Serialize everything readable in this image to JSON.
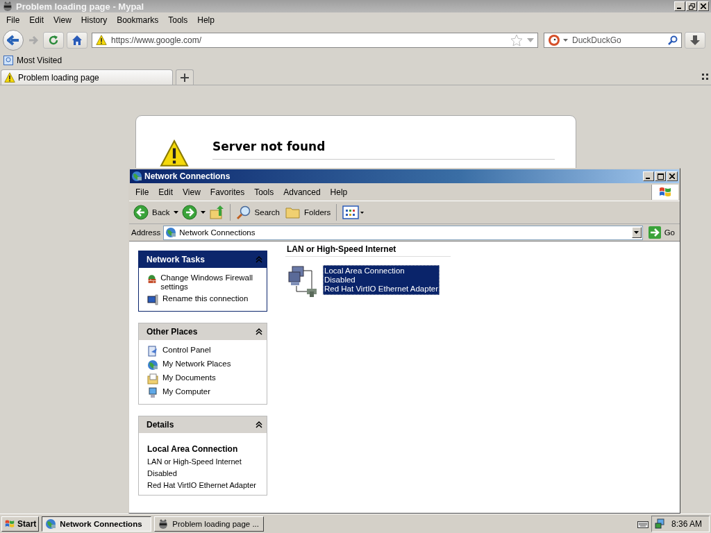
{
  "browser": {
    "title": "Problem loading page - Mypal",
    "menu": [
      "File",
      "Edit",
      "View",
      "History",
      "Bookmarks",
      "Tools",
      "Help"
    ],
    "url": "https://www.google.com/",
    "search": {
      "placeholder": "DuckDuckGo"
    },
    "bookmarks": [
      "Most Visited"
    ],
    "tabs": [
      {
        "label": "Problem loading page",
        "selected": true
      }
    ],
    "error": {
      "heading": "Server not found"
    }
  },
  "explorer": {
    "title": "Network Connections",
    "menu": [
      "File",
      "Edit",
      "View",
      "Favorites",
      "Tools",
      "Advanced",
      "Help"
    ],
    "toolbar": [
      {
        "kind": "back",
        "label": "Back"
      },
      {
        "kind": "forward"
      },
      {
        "kind": "up"
      },
      {
        "kind": "search",
        "label": "Search"
      },
      {
        "kind": "folders",
        "label": "Folders"
      },
      {
        "kind": "views"
      }
    ],
    "address": {
      "label": "Address",
      "value": "Network Connections",
      "go": "Go"
    },
    "sections": [
      {
        "kind": "tasks",
        "title": "Network Tasks",
        "items": [
          {
            "label": "Change Windows Firewall settings"
          },
          {
            "label": "Rename this connection"
          }
        ]
      },
      {
        "kind": "places",
        "title": "Other Places",
        "items": [
          {
            "label": "Control Panel"
          },
          {
            "label": "My Network Places"
          },
          {
            "label": "My Documents"
          },
          {
            "label": "My Computer"
          }
        ]
      },
      {
        "kind": "details",
        "title": "Details",
        "name": "Local Area Connection",
        "lines": [
          "LAN or High-Speed Internet",
          "Disabled",
          "Red Hat VirtIO Ethernet Adapter"
        ]
      }
    ],
    "group": "LAN or High-Speed Internet",
    "connections": [
      {
        "lines": [
          "Local Area Connection",
          "Disabled",
          "Red Hat VirtIO Ethernet Adapter"
        ],
        "selected": true
      }
    ]
  },
  "taskbar": {
    "start": "Start",
    "tasks": [
      {
        "label": "Network Connections",
        "selected": true
      },
      {
        "label": "Problem loading page ...",
        "selected": false
      }
    ],
    "clock": "8:36 AM"
  }
}
